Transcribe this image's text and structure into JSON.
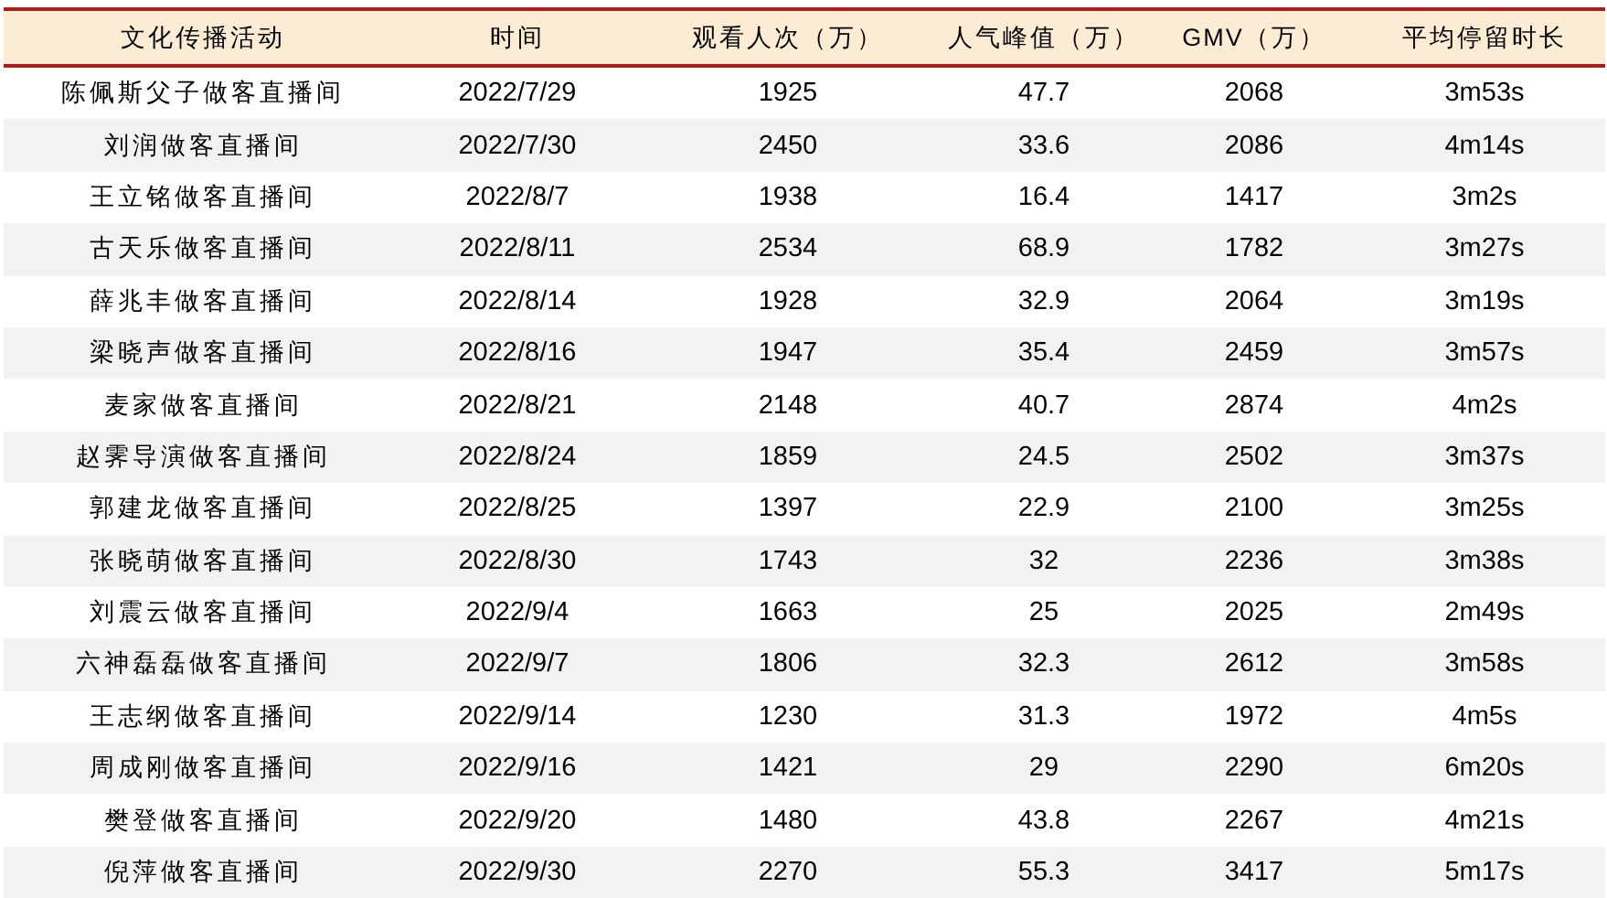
{
  "table": {
    "columns": [
      "文化传播活动",
      "时间",
      "观看人次（万）",
      "人气峰值（万）",
      "GMV（万）",
      "平均停留时长"
    ],
    "rows": [
      [
        "陈佩斯父子做客直播间",
        "2022/7/29",
        "1925",
        "47.7",
        "2068",
        "3m53s"
      ],
      [
        "刘润做客直播间",
        "2022/7/30",
        "2450",
        "33.6",
        "2086",
        "4m14s"
      ],
      [
        "王立铭做客直播间",
        "2022/8/7",
        "1938",
        "16.4",
        "1417",
        "3m2s"
      ],
      [
        "古天乐做客直播间",
        "2022/8/11",
        "2534",
        "68.9",
        "1782",
        "3m27s"
      ],
      [
        "薛兆丰做客直播间",
        "2022/8/14",
        "1928",
        "32.9",
        "2064",
        "3m19s"
      ],
      [
        "梁晓声做客直播间",
        "2022/8/16",
        "1947",
        "35.4",
        "2459",
        "3m57s"
      ],
      [
        "麦家做客直播间",
        "2022/8/21",
        "2148",
        "40.7",
        "2874",
        "4m2s"
      ],
      [
        "赵霁导演做客直播间",
        "2022/8/24",
        "1859",
        "24.5",
        "2502",
        "3m37s"
      ],
      [
        "郭建龙做客直播间",
        "2022/8/25",
        "1397",
        "22.9",
        "2100",
        "3m25s"
      ],
      [
        "张晓萌做客直播间",
        "2022/8/30",
        "1743",
        "32",
        "2236",
        "3m38s"
      ],
      [
        "刘震云做客直播间",
        "2022/9/4",
        "1663",
        "25",
        "2025",
        "2m49s"
      ],
      [
        "六神磊磊做客直播间",
        "2022/9/7",
        "1806",
        "32.3",
        "2612",
        "3m58s"
      ],
      [
        "王志纲做客直播间",
        "2022/9/14",
        "1230",
        "31.3",
        "1972",
        "4m5s"
      ],
      [
        "周成刚做客直播间",
        "2022/9/16",
        "1421",
        "29",
        "2290",
        "6m20s"
      ],
      [
        "樊登做客直播间",
        "2022/9/20",
        "1480",
        "43.8",
        "2267",
        "4m21s"
      ],
      [
        "倪萍做客直播间",
        "2022/9/30",
        "2270",
        "55.3",
        "3417",
        "5m17s"
      ]
    ]
  }
}
